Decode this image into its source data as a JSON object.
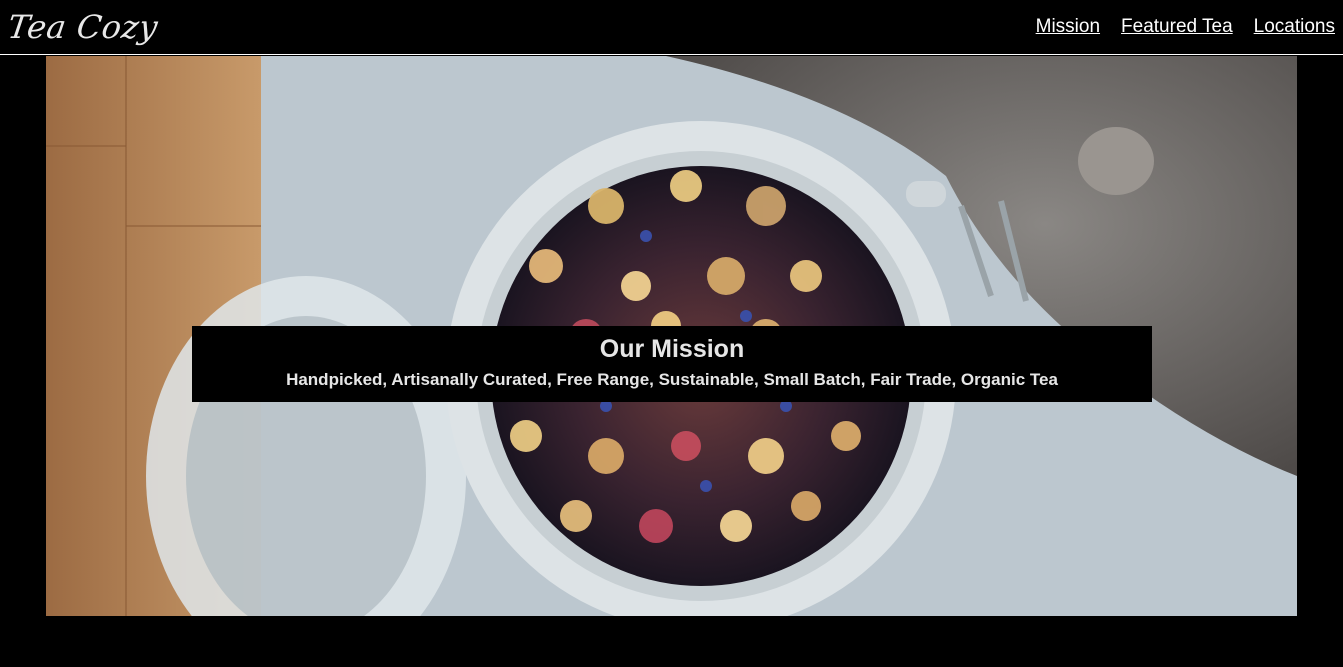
{
  "header": {
    "logo": "Tea Cozy",
    "nav": [
      {
        "label": "Mission"
      },
      {
        "label": "Featured Tea"
      },
      {
        "label": "Locations"
      }
    ]
  },
  "mission": {
    "title": "Our Mission",
    "text": "Handpicked, Artisanally Curated, Free Range, Sustainable, Small Batch, Fair Trade, Organic Tea"
  },
  "colors": {
    "background": "#000000",
    "text": "#ffffff"
  }
}
